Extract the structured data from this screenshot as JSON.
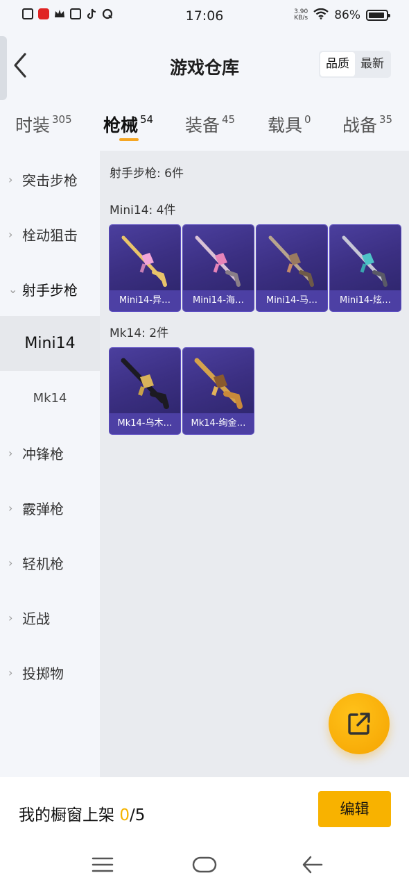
{
  "status_bar": {
    "time": "17:06",
    "net_speed_value": "3.90",
    "net_speed_unit": "KB/s",
    "battery": "86%",
    "icons": [
      "notification-icon",
      "app-red-icon",
      "crown-icon",
      "wallet-icon",
      "tiktok-icon",
      "q-icon",
      "wifi-icon",
      "battery-icon"
    ]
  },
  "header": {
    "title": "游戏仓库",
    "sort": {
      "quality": "品质",
      "latest": "最新"
    }
  },
  "tabs": [
    {
      "label": "时装",
      "count": "305"
    },
    {
      "label": "枪械",
      "count": "54"
    },
    {
      "label": "装备",
      "count": "45"
    },
    {
      "label": "载具",
      "count": "0"
    },
    {
      "label": "战备",
      "count": "35"
    }
  ],
  "sidebar": {
    "items": [
      {
        "label": "突击步枪"
      },
      {
        "label": "栓动狙击"
      },
      {
        "label": "射手步枪"
      },
      {
        "label": "Mini14"
      },
      {
        "label": "Mk14"
      },
      {
        "label": "冲锋枪"
      },
      {
        "label": "霰弹枪"
      },
      {
        "label": "轻机枪"
      },
      {
        "label": "近战"
      },
      {
        "label": "投掷物"
      }
    ]
  },
  "content": {
    "category_summary": "射手步枪: 6件",
    "groups": [
      {
        "label": "Mini14: 4件",
        "items": [
          "Mini14-异…",
          "Mini14-海…",
          "Mini14-马…",
          "Mini14-炫…"
        ]
      },
      {
        "label": "Mk14: 2件",
        "items": [
          "Mk14-乌木…",
          "Mk14-绚金…"
        ]
      }
    ]
  },
  "bottom": {
    "shelf_label": "我的橱窗上架",
    "shelf_current": "0",
    "shelf_total": "/5",
    "edit_label": "编辑"
  },
  "colors": {
    "accent": "#f8b200",
    "card_bg": "#3b2f82",
    "background": "#f4f6fa"
  }
}
